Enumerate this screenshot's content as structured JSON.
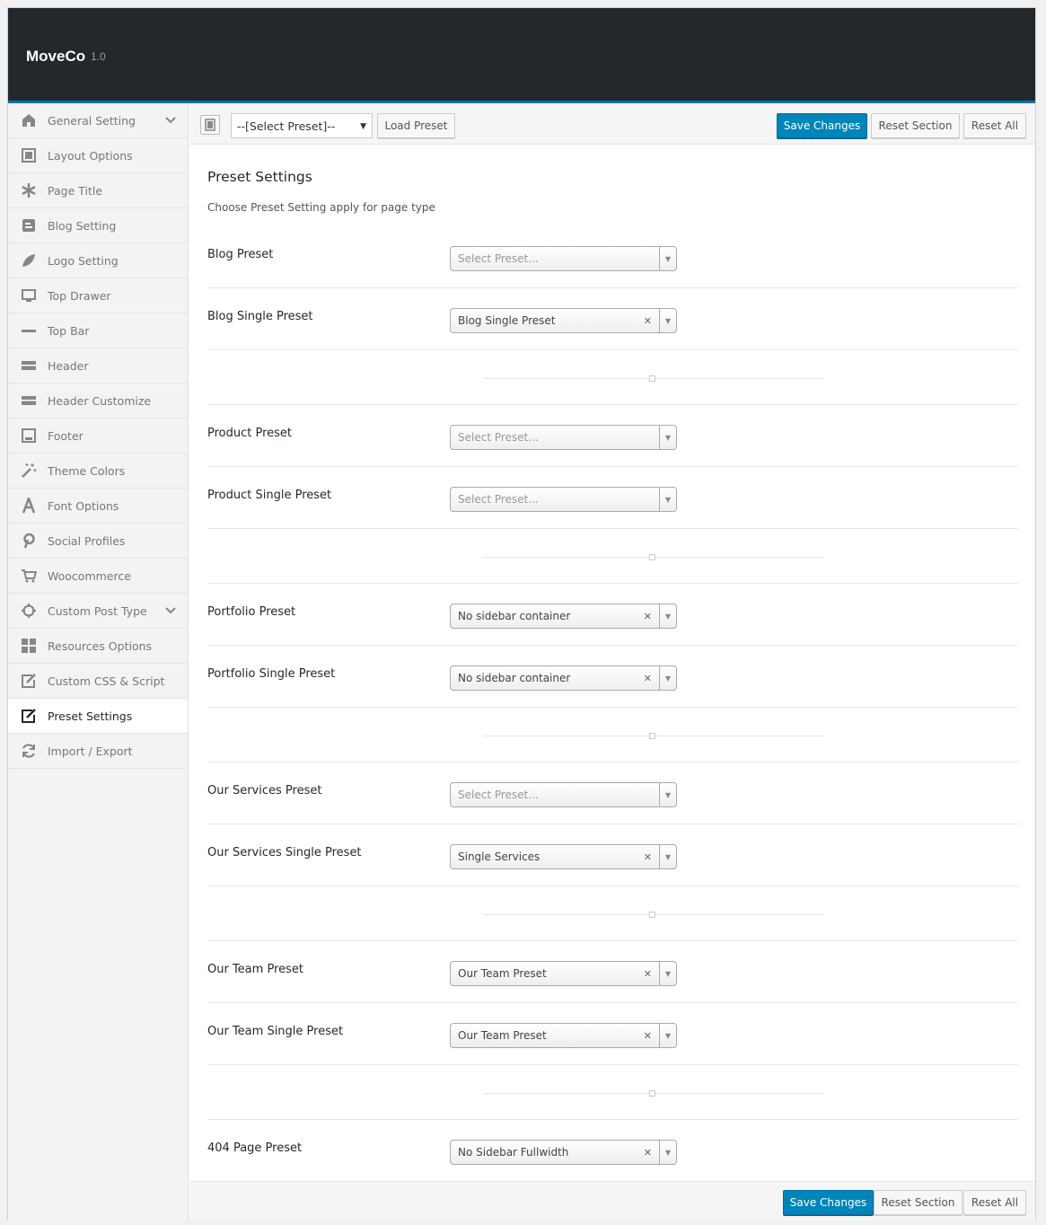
{
  "app": {
    "name": "MoveCo",
    "version": "1.0"
  },
  "sidebar": {
    "items": [
      {
        "label": "General Setting",
        "icon": "home-icon",
        "has_chevron": true
      },
      {
        "label": "Layout Options",
        "icon": "layout-icon"
      },
      {
        "label": "Page Title",
        "icon": "asterisk-icon"
      },
      {
        "label": "Blog Setting",
        "icon": "blog-icon"
      },
      {
        "label": "Logo Setting",
        "icon": "leaf-icon"
      },
      {
        "label": "Top Drawer",
        "icon": "monitor-icon"
      },
      {
        "label": "Top Bar",
        "icon": "minus-icon"
      },
      {
        "label": "Header",
        "icon": "header-icon"
      },
      {
        "label": "Header Customize",
        "icon": "header-customize-icon"
      },
      {
        "label": "Footer",
        "icon": "footer-icon"
      },
      {
        "label": "Theme Colors",
        "icon": "magic-wand-icon"
      },
      {
        "label": "Font Options",
        "icon": "font-icon"
      },
      {
        "label": "Social Profiles",
        "icon": "pinterest-icon"
      },
      {
        "label": "Woocommerce",
        "icon": "cart-icon"
      },
      {
        "label": "Custom Post Type",
        "icon": "crosshair-icon",
        "has_chevron": true
      },
      {
        "label": "Resources Options",
        "icon": "grid-icon"
      },
      {
        "label": "Custom CSS & Script",
        "icon": "edit-icon"
      },
      {
        "label": "Preset Settings",
        "icon": "edit-icon",
        "active": true
      },
      {
        "label": "Import / Export",
        "icon": "refresh-icon"
      }
    ]
  },
  "toolbar": {
    "preset_select_value": "--[Select Preset]--",
    "load_preset_label": "Load Preset",
    "save_label": "Save Changes",
    "reset_section_label": "Reset Section",
    "reset_all_label": "Reset All"
  },
  "section": {
    "title": "Preset Settings",
    "description": "Choose Preset Setting apply for page type"
  },
  "fields": [
    {
      "label": "Blog Preset",
      "value": "Select Preset...",
      "placeholder": true
    },
    {
      "label": "Blog Single Preset",
      "value": "Blog Single Preset",
      "placeholder": false
    },
    {
      "label": "Product Preset",
      "value": "Select Preset...",
      "placeholder": true
    },
    {
      "label": "Product Single Preset",
      "value": "Select Preset...",
      "placeholder": true
    },
    {
      "label": "Portfolio Preset",
      "value": "No sidebar container",
      "placeholder": false
    },
    {
      "label": "Portfolio Single Preset",
      "value": "No sidebar container",
      "placeholder": false
    },
    {
      "label": "Our Services Preset",
      "value": "Select Preset...",
      "placeholder": true
    },
    {
      "label": "Our Services Single Preset",
      "value": "Single Services",
      "placeholder": false
    },
    {
      "label": "Our Team Preset",
      "value": "Our Team Preset",
      "placeholder": false
    },
    {
      "label": "Our Team Single Preset",
      "value": "Our Team Preset",
      "placeholder": false
    },
    {
      "label": "404 Page Preset",
      "value": "No Sidebar Fullwidth",
      "placeholder": false
    }
  ],
  "footer": {
    "save_label": "Save Changes",
    "reset_section_label": "Reset Section",
    "reset_all_label": "Reset All"
  },
  "colors": {
    "header_bg": "#23282d",
    "accent": "#0073aa",
    "primary_button": "#0085ba"
  }
}
